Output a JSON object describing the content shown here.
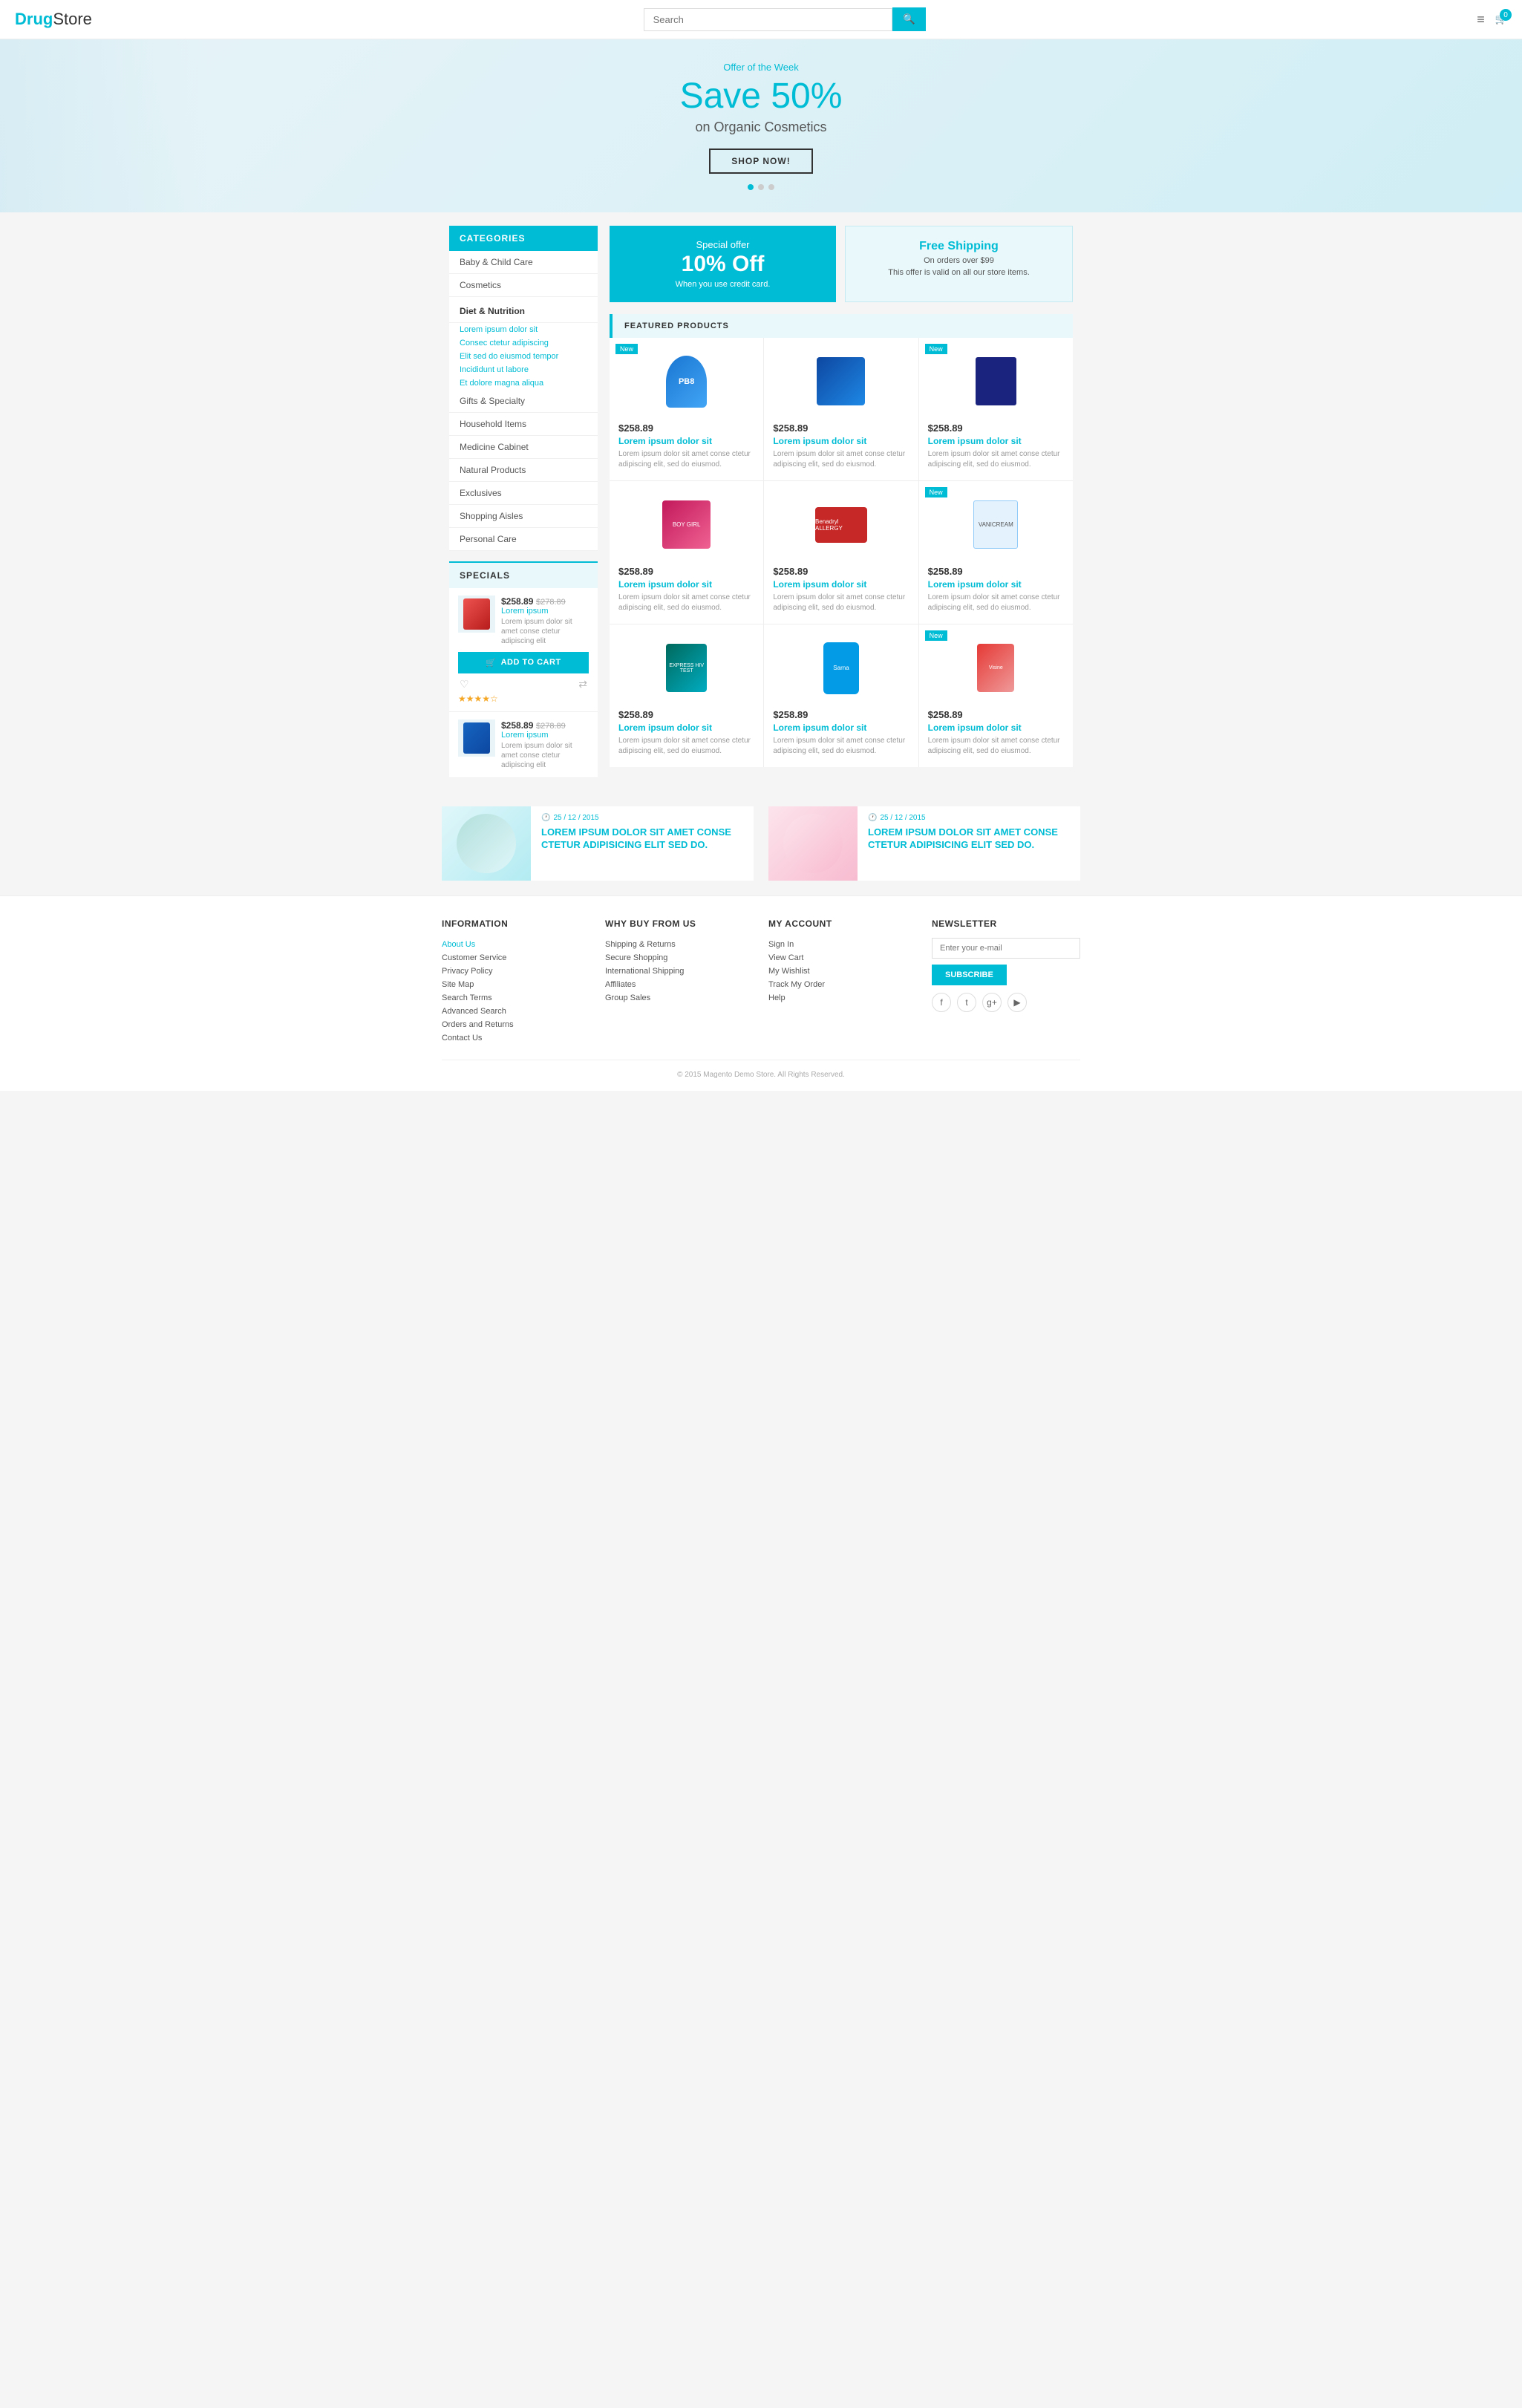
{
  "header": {
    "logo_drug": "Drug",
    "logo_store": "Store",
    "search_placeholder": "Search",
    "search_btn_icon": "🔍",
    "menu_icon": "≡",
    "cart_count": "0"
  },
  "hero": {
    "offer_label": "Offer of the Week",
    "title_save": "Save 50%",
    "title_sub": "on Organic Cosmetics",
    "shop_now": "SHOP NOW!"
  },
  "sidebar": {
    "categories_header": "CATEGORIES",
    "items": [
      {
        "label": "Baby & Child Care",
        "type": "link"
      },
      {
        "label": "Cosmetics",
        "type": "link"
      },
      {
        "label": "Diet & Nutrition",
        "type": "section"
      },
      {
        "label": "Lorem ipsum dolor sit",
        "type": "sub"
      },
      {
        "label": "Consec ctetur adipiscing",
        "type": "sub"
      },
      {
        "label": "Elit sed do eiusmod tempor",
        "type": "sub"
      },
      {
        "label": "Incididunt ut labore",
        "type": "sub"
      },
      {
        "label": "Et dolore magna aliqua",
        "type": "sub"
      },
      {
        "label": "Gifts & Specialty",
        "type": "link"
      },
      {
        "label": "Household Items",
        "type": "link"
      },
      {
        "label": "Medicine Cabinet",
        "type": "link"
      },
      {
        "label": "Natural Products",
        "type": "link"
      },
      {
        "label": "Exclusives",
        "type": "link"
      },
      {
        "label": "Shopping Aisles",
        "type": "link"
      },
      {
        "label": "Personal Care",
        "type": "link"
      }
    ],
    "specials_header": "SPECIALS",
    "special_items": [
      {
        "price": "$258.89",
        "old_price": "$278.89",
        "name": "Lorem ipsum",
        "desc": "Lorem ipsum dolor sit amet conse ctetur adipiscing elit",
        "add_to_cart": "ADD TO CART",
        "stars": "★★★★☆"
      },
      {
        "price": "$258.89",
        "old_price": "$278.89",
        "name": "Lorem ipsum",
        "desc": "Lorem ipsum dolor sit amet conse ctetur adipiscing elit",
        "stars": ""
      }
    ]
  },
  "promo": {
    "left": {
      "label": "Special offer",
      "big": "10% Off",
      "sub": "When you use credit card."
    },
    "right": {
      "label": "Free Shipping",
      "sub1": "On orders over $99",
      "sub2": "This offer is valid on all our store items."
    }
  },
  "featured": {
    "header": "FEATURED PRODUCTS",
    "products": [
      {
        "badge": "New",
        "price": "$258.89",
        "name": "Lorem ipsum dolor sit",
        "desc": "Lorem ipsum dolor sit amet conse ctetur adipiscing elit, sed do eiusmod."
      },
      {
        "badge": "",
        "price": "$258.89",
        "name": "Lorem ipsum dolor sit",
        "desc": "Lorem ipsum dolor sit amet conse ctetur adipiscing elit, sed do eiusmod."
      },
      {
        "badge": "New",
        "price": "$258.89",
        "name": "Lorem ipsum dolor sit",
        "desc": "Lorem ipsum dolor sit amet conse ctetur adipiscing elit, sed do eiusmod."
      },
      {
        "badge": "",
        "price": "$258.89",
        "name": "Lorem ipsum dolor sit",
        "desc": "Lorem ipsum dolor sit amet conse ctetur adipiscing elit, sed do eiusmod."
      },
      {
        "badge": "",
        "price": "$258.89",
        "name": "Lorem ipsum dolor sit",
        "desc": "Lorem ipsum dolor sit amet conse ctetur adipiscing elit, sed do eiusmod."
      },
      {
        "badge": "New",
        "price": "$258.89",
        "name": "Lorem ipsum dolor sit",
        "desc": "Lorem ipsum dolor sit amet conse ctetur adipiscing elit, sed do eiusmod."
      },
      {
        "badge": "",
        "price": "$258.89",
        "name": "Lorem ipsum dolor sit",
        "desc": "Lorem ipsum dolor sit amet conse ctetur adipiscing elit, sed do eiusmod."
      },
      {
        "badge": "",
        "price": "$258.89",
        "name": "Lorem ipsum dolor sit",
        "desc": "Lorem ipsum dolor sit amet conse ctetur adipiscing elit, sed do eiusmod."
      },
      {
        "badge": "New",
        "price": "$258.89",
        "name": "Lorem ipsum dolor sit",
        "desc": "Lorem ipsum dolor sit amet conse ctetur adipiscing elit, sed do eiusmod."
      }
    ]
  },
  "blog": {
    "posts": [
      {
        "date": "25 / 12 / 2015",
        "title": "LOREM IPSUM DOLOR SIT AMET CONSE CTETUR ADIPISICING ELIT SED DO."
      },
      {
        "date": "25 / 12 / 2015",
        "title": "LOREM IPSUM DOLOR SIT AMET CONSE CTETUR ADIPISICING ELIT SED DO."
      }
    ]
  },
  "footer": {
    "info_header": "INFORMATION",
    "info_links": [
      "About Us",
      "Customer Service",
      "Privacy Policy",
      "Site Map",
      "Search Terms",
      "Advanced Search",
      "Orders and Returns",
      "Contact Us"
    ],
    "why_header": "WHY BUY FROM US",
    "why_links": [
      "Shipping & Returns",
      "Secure Shopping",
      "International Shipping",
      "Affiliates",
      "Group Sales"
    ],
    "account_header": "MY ACCOUNT",
    "account_links": [
      "Sign In",
      "View Cart",
      "My Wishlist",
      "Track My Order",
      "Help"
    ],
    "newsletter_header": "NEWSLETTER",
    "newsletter_placeholder": "Enter your e-mail",
    "subscribe_btn": "SUBSCRIBE",
    "social_icons": [
      "f",
      "t",
      "g+",
      "▶"
    ],
    "copyright": "© 2015 Magento Demo Store. All Rights Reserved."
  }
}
